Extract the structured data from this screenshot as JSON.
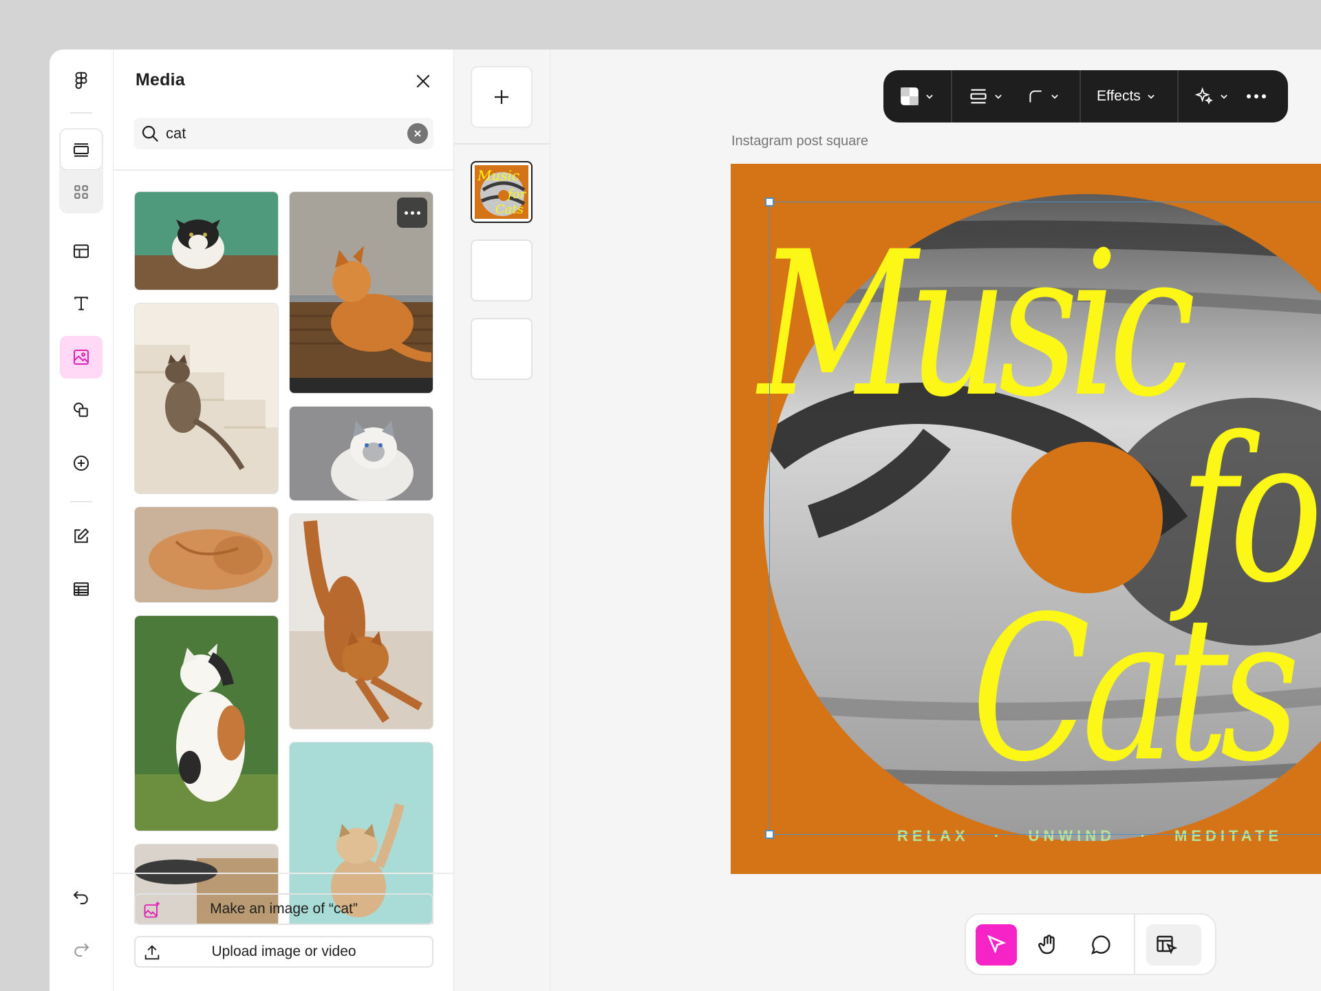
{
  "rail": {
    "items": [
      "figma-logo-icon",
      "layers-icon",
      "grid-icon",
      "layout-icon",
      "text-icon",
      "image-icon",
      "shapes-icon",
      "add-circle-icon",
      "edit-icon",
      "table-icon",
      "undo-icon",
      "redo-icon"
    ]
  },
  "panel": {
    "title": "Media",
    "search": {
      "value": "cat",
      "placeholder": "Search"
    },
    "actions": {
      "make_image": "Make an image of “cat”",
      "upload": "Upload image or video"
    }
  },
  "toolbar": {
    "effects_label": "Effects"
  },
  "canvas": {
    "frame_label": "Instagram post square",
    "title_word1": "Music",
    "title_word2": "for",
    "title_word3": "Cats",
    "tagline": "RELAX   ·   UNWIND   ·   MEDITATE"
  },
  "colors": {
    "accent": "#f623c7",
    "artboard": "#d57317",
    "title_yellow": "#fcf717",
    "tagline_green": "#b5e39a",
    "selection_blue": "#4a90c8"
  }
}
